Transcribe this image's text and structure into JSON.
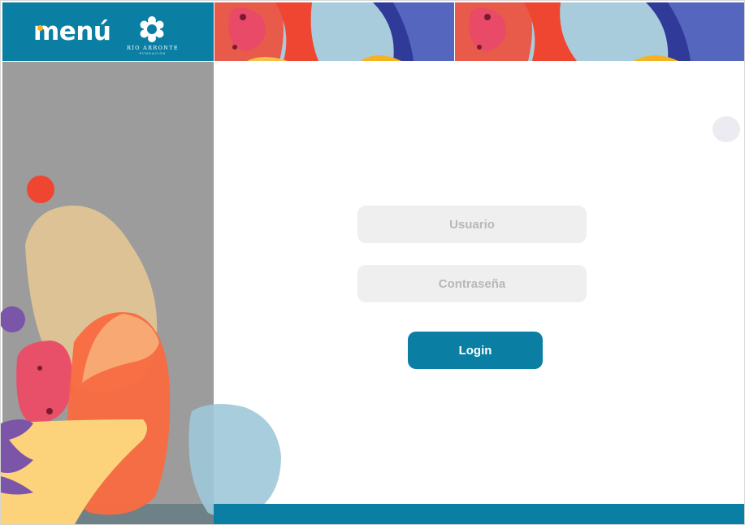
{
  "brand": {
    "app_name": "menú",
    "foundation_name": "RÍO ARRONTE",
    "foundation_sub": "FUNDACIÓN"
  },
  "login": {
    "username_placeholder": "Usuario",
    "password_placeholder": "Contraseña",
    "login_label": "Login"
  },
  "colors": {
    "primary": "#0a7fa3",
    "side_panel": "#9c9c9c",
    "input_bg": "#efefef",
    "accent_yellow": "#f5b321"
  },
  "icons": {
    "foundation_logo": "flower-ring-icon"
  }
}
